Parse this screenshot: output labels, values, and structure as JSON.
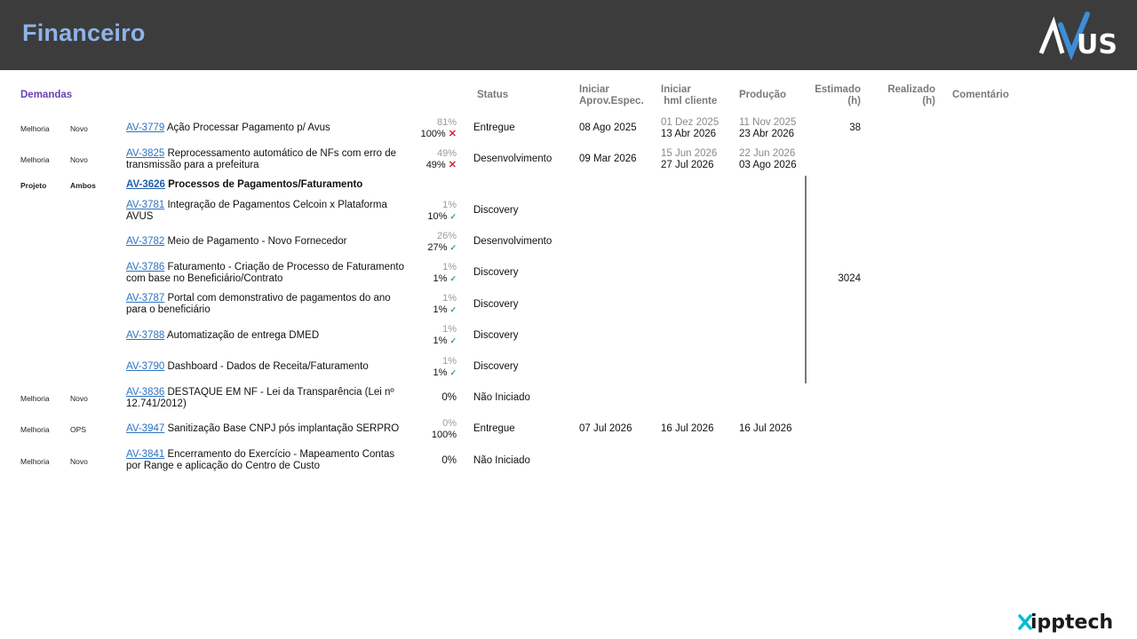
{
  "header": {
    "title": "Financeiro",
    "logo": "AVUS",
    "logo_color": "#3c8ed8"
  },
  "columns": {
    "demandas": "Demandas",
    "status": "Status",
    "iniciar_aprov_1": "Iniciar",
    "iniciar_aprov_2": "Aprov.Espec.",
    "iniciar_hml_1": "Iniciar",
    "iniciar_hml_2": "hml cliente",
    "producao": "Produção",
    "estimado_1": "Estimado",
    "estimado_2": "(h)",
    "realizado_1": "Realizado",
    "realizado_2": "(h)",
    "comentario": "Comentário"
  },
  "rows": [
    {
      "tipo": "Melhoria",
      "origem": "Novo",
      "id": "AV-3779",
      "desc": "Ação Processar Pagamento p/ Avus",
      "pct1": "81%",
      "pct2": "100%",
      "mark": "✕",
      "status": "Entregue",
      "aprov": "08 Ago 2025",
      "hml1": "01 Dez 2025",
      "hml2": "13 Abr 2026",
      "prod1": "11 Nov 2025",
      "prod2": "23 Abr 2026",
      "estimado": "38"
    },
    {
      "tipo": "Melhoria",
      "origem": "Novo",
      "id": "AV-3825",
      "desc": " Reprocessamento automático de NFs com erro de transmissão para a prefeitura",
      "pct1": "49%",
      "pct2": "49%",
      "mark": "✕",
      "status": "Desenvolvimento",
      "aprov": "09 Mar 2026",
      "hml1": "15 Jun 2026",
      "hml2": "27 Jul 2026",
      "prod1": "22 Jun 2026",
      "prod2": "03 Ago 2026"
    },
    {
      "tipo": "Projeto",
      "origem": "Ambos",
      "id": "AV-3626",
      "desc": "Processos de Pagamentos/Faturamento"
    },
    {
      "id": "AV-3781",
      "desc": "Integração de Pagamentos Celcoin x Plataforma AVUS",
      "pct1": "1%",
      "pct2": "10%",
      "mark": "✓",
      "status": "Discovery"
    },
    {
      "id": "AV-3782",
      "desc": "Meio de Pagamento - Novo Fornecedor",
      "pct1": "26%",
      "pct2": "27%",
      "mark": "✓",
      "status": "Desenvolvimento"
    },
    {
      "id": "AV-3786",
      "desc": "Faturamento - Criação de Processo de Faturamento com base no Beneficiário/Contrato",
      "pct1": "1%",
      "pct2": "1%",
      "mark": "✓",
      "status": "Discovery",
      "estimado": "3024"
    },
    {
      "id": "AV-3787",
      "desc": "Portal com demonstrativo de pagamentos do ano para o beneficiário",
      "pct1": "1%",
      "pct2": "1%",
      "mark": "✓",
      "status": "Discovery"
    },
    {
      "id": "AV-3788",
      "desc": "Automatização de entrega DMED",
      "pct1": "1%",
      "pct2": "1%",
      "mark": "✓",
      "status": "Discovery"
    },
    {
      "id": "AV-3790",
      "desc": "Dashboard - Dados de Receita/Faturamento",
      "pct1": "1%",
      "pct2": "1%",
      "mark": "✓",
      "status": "Discovery"
    },
    {
      "tipo": "Melhoria",
      "origem": "Novo",
      "id": "AV-3836",
      "desc": "DESTAQUE EM NF - Lei da Transparência (Lei nº 12.741/2012)",
      "pct": "0%",
      "status": "Não Iniciado"
    },
    {
      "tipo": "Melhoria",
      "origem": "OPS",
      "id": "AV-3947",
      "desc": "Sanitização Base CNPJ pós implantação SERPRO",
      "pct1": "0%",
      "pct2": "100%",
      "status": "Entregue",
      "aprov": "07 Jul 2026",
      "hml": "16 Jul 2026",
      "prod": "16 Jul 2026"
    },
    {
      "tipo": "Melhoria",
      "origem": "Novo",
      "id": "AV-3841",
      "desc": "Encerramento do Exercício - Mapeamento Contas por Range e aplicação do Centro de Custo",
      "pct": "0%",
      "status": "Não Iniciado"
    }
  ],
  "footer": {
    "brand": "xipptech"
  }
}
